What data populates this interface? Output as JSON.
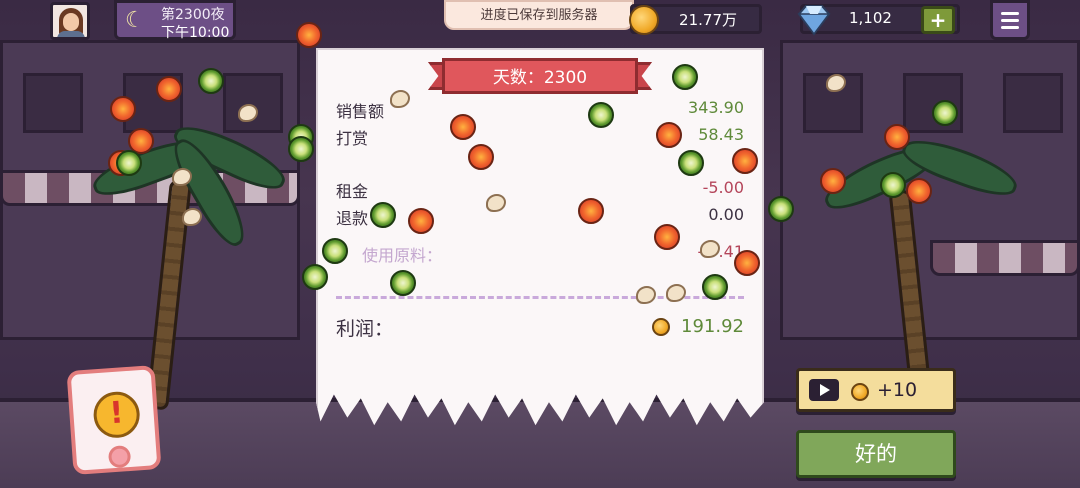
{
  "hud": {
    "night_label": "第2300夜",
    "time": "下午10:00",
    "save_toast": "进度已保存到服务器",
    "coins": "21.77万",
    "gems": "1,102",
    "plus": "+"
  },
  "receipt": {
    "day_title": "天数：2300",
    "rows": [
      {
        "label": "销售额",
        "value": "343.90"
      },
      {
        "label": "打赏",
        "value": "58.43"
      },
      {
        "label": "租金",
        "value": "-5.00"
      },
      {
        "label": "退款",
        "value": "0.00"
      },
      {
        "label": "使用原料：",
        "value": "-2 .41"
      }
    ],
    "profit_label": "利润：",
    "profit_value": "191.92"
  },
  "buttons": {
    "video_reward": "+10",
    "ok": "好的",
    "alert_mark": "!"
  },
  "colors": {
    "positive": "#5f8a3a",
    "negative": "#b4455a",
    "ribbon": "#e0575c",
    "ok_button": "#80a75a"
  },
  "icons": [
    "avatar-icon",
    "moon-icon",
    "coin-icon",
    "diamond-icon",
    "menu-icon",
    "play-video-icon",
    "alert-icon"
  ]
}
